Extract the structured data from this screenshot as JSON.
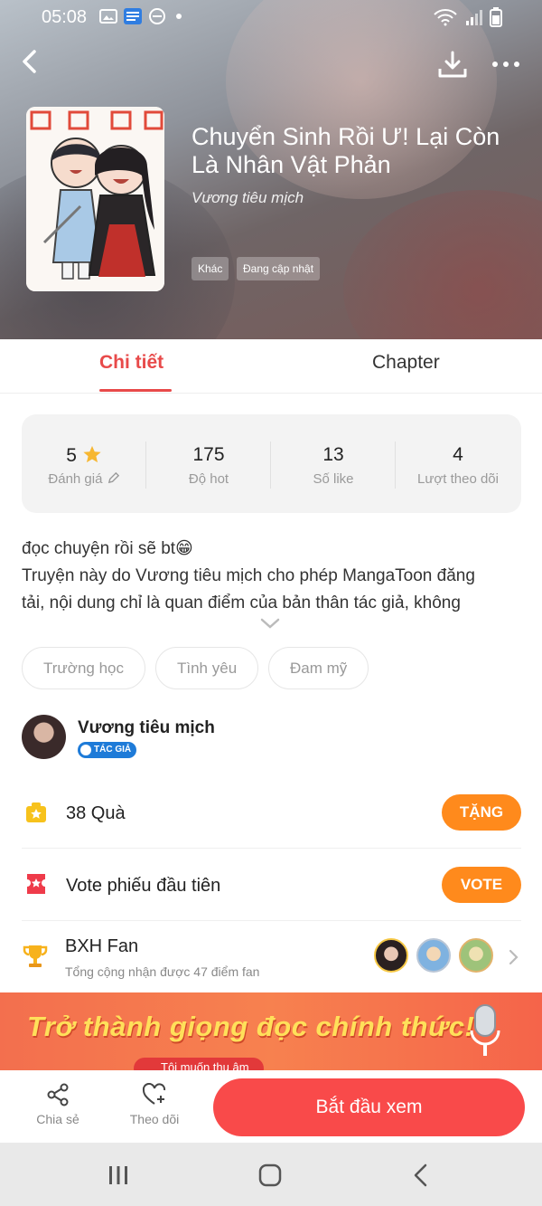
{
  "status_bar": {
    "time": "05:08"
  },
  "comic": {
    "title": "Chuyển Sinh Rồi Ư! Lại Còn Là Nhân Vật Phản",
    "author": "Vương tiêu mịch",
    "tags_top": [
      "Khác",
      "Đang cập nhật"
    ]
  },
  "tabs": [
    {
      "label": "Chi tiết",
      "active": true
    },
    {
      "label": "Chapter",
      "active": false
    }
  ],
  "stats": [
    {
      "value": "5",
      "label": "Đánh giá",
      "icon": "star-icon"
    },
    {
      "value": "175",
      "label": "Độ hot"
    },
    {
      "value": "13",
      "label": "Số like"
    },
    {
      "value": "4",
      "label": "Lượt theo dõi"
    }
  ],
  "description": {
    "line1": "đọc chuyện rồi sẽ bt😁",
    "line2": "Truyện này do Vương tiêu mịch cho phép MangaToon đăng",
    "line3": "tải, nội dung chỉ là quan điểm của bản thân tác giả, không"
  },
  "genres": [
    "Trường học",
    "Tình yêu",
    "Đam mỹ"
  ],
  "author_row": {
    "name": "Vương tiêu mịch",
    "badge": "TÁC GIẢ"
  },
  "gift_row": {
    "text": "38 Quà",
    "button": "TẶNG"
  },
  "vote_row": {
    "text": "Vote phiếu đầu tiên",
    "button": "VOTE"
  },
  "fan_row": {
    "title": "BXH Fan",
    "subtitle": "Tổng cộng nhận được 47 điểm fan"
  },
  "banner": {
    "headline": "Trở thành giọng đọc chính thức!",
    "cta": "Tôi muốn thu âm"
  },
  "action_bar": {
    "share": "Chia sẻ",
    "follow": "Theo dõi",
    "start": "Bắt đầu xem"
  },
  "colors": {
    "accent": "#e84a4a",
    "orange": "#ff8a1c",
    "start_button": "#f94a4a"
  }
}
